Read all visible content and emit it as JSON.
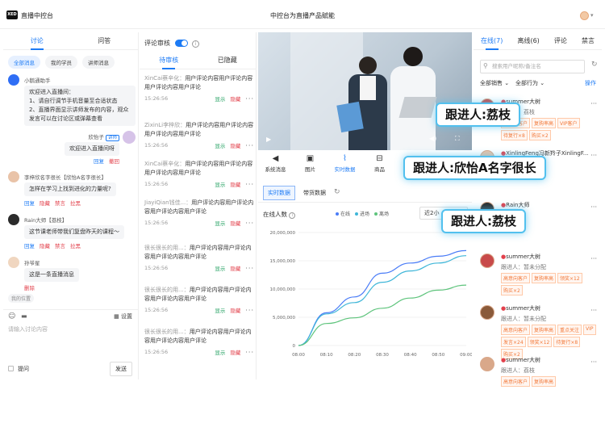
{
  "header": {
    "logo": "XED",
    "app_title": "直播中控台",
    "page_title": "中控台为直播产品赋能"
  },
  "chat": {
    "tabs": [
      "讨论",
      "问答"
    ],
    "filters": [
      "全部消息",
      "我的学员",
      "讲师消息"
    ],
    "assistant": {
      "name": "小鹅通助手",
      "text": "欢迎进入直播间：\n1、请自行调节手机音量至合适状态\n2、直播界面显示讲师发布的内容，观众发言可以在讨论区或弹幕查看"
    },
    "teacher": {
      "name": "欣怡子",
      "badge": "讲师",
      "text": "欢迎进入直播间呀",
      "actions": [
        "回复",
        "撤回"
      ]
    },
    "m1": {
      "name": "李梓欣名字很长【欣怡A名字很长】",
      "text": "怎样在学习上找到进化的力量呢?",
      "actions": [
        "回复",
        "隐藏",
        "禁言",
        "拉黑"
      ]
    },
    "m2": {
      "name": "Rain大师【荔枝】",
      "text": "这节课老师带我们复盘昨天的课程～",
      "actions": [
        "回复",
        "隐藏",
        "禁言",
        "拉黑"
      ]
    },
    "m3": {
      "name": "孙爷星",
      "text": "这是一条直播消息",
      "action": "删除",
      "location": "我的位置"
    },
    "composer": {
      "settings": "设置",
      "placeholder": "请输入讨论内容",
      "question": "提问",
      "send": "发送"
    }
  },
  "review": {
    "title": "评论审核",
    "tabs": [
      "待审核",
      "已隐藏"
    ],
    "items": [
      {
        "nick": "XinCai蔡辛化：",
        "text": "用户评论内容用户评论内容用户评论内容用户评论",
        "time": "15:26:56"
      },
      {
        "nick": "ZixinLi李梓欣：",
        "text": "用户评论内容用户评论内容用户评论内容用户评论",
        "time": "15:26:56"
      },
      {
        "nick": "XinCai蔡辛化：",
        "text": "用户评论内容用户评论内容用户评论内容用户评论",
        "time": "15:26:56"
      },
      {
        "nick": "JiayiQian钱佳...：",
        "text": "用户评论内容用户评论内容用户评论内容用户评论",
        "time": "15:26:56"
      },
      {
        "nick": "很长很长的用...：",
        "text": "用户评论内容用户评论内容用户评论内容用户评论",
        "time": "15:26:56"
      },
      {
        "nick": "很长很长的用...：",
        "text": "用户评论内容用户评论内容用户评论内容用户评论",
        "time": "15:26:56"
      },
      {
        "nick": "很长很长的用...：",
        "text": "用户评论内容用户评论内容用户评论内容用户评论",
        "time": "15:26:56"
      }
    ],
    "show": "显示",
    "hide": "隐藏"
  },
  "center": {
    "toolbar": [
      "系统消息",
      "图片",
      "实时数据",
      "商品",
      "评"
    ],
    "subtabs": [
      "实时数据",
      "带货数据"
    ],
    "chart_label": "在线人数",
    "range": "近2小"
  },
  "chart_data": {
    "type": "line",
    "x": [
      "08:00",
      "08:10",
      "08:20",
      "08:30",
      "08:40",
      "08:50",
      "09:00"
    ],
    "legend": [
      "在线",
      "进场",
      "离场"
    ],
    "series": [
      {
        "name": "在线",
        "values": [
          0,
          5800000,
          8600000,
          12800000,
          14600000,
          15800000,
          16800000
        ]
      },
      {
        "name": "进场",
        "values": [
          0,
          5600000,
          7600000,
          11200000,
          13200000,
          14600000,
          15900000
        ]
      },
      {
        "name": "离场",
        "values": [
          0,
          3900000,
          4900000,
          6600000,
          8400000,
          9800000,
          10700000
        ]
      }
    ],
    "yticks": [
      "20,000,000",
      "15,000,000",
      "10,000,000",
      "5,000,000",
      "0"
    ],
    "ylim": [
      0,
      20000000
    ],
    "colors": [
      "#4a7cf7",
      "#3fb6d8",
      "#5ec47c"
    ]
  },
  "viewers": {
    "tabs": [
      "在线(7)",
      "离线(6)",
      "评论",
      "禁言"
    ],
    "search_placeholder": "搜索用户昵称/备注名",
    "sales_filter": "全部销售",
    "all_filter": "全部行为",
    "op": "操作",
    "list": [
      {
        "name": "summer大树",
        "sub": "跟进人：荔枝",
        "tags": [
          "高意向客户",
          "复购率高",
          "VIP客户",
          "待复行×8",
          "购买×2"
        ]
      },
      {
        "name": "XinlingFeng冯新羚子XinlingF...",
        "sub": "",
        "tags": []
      },
      {
        "name": "Rain大师",
        "sub": "",
        "tags": []
      },
      {
        "name": "summer大树",
        "sub": "跟进人：暂未分配",
        "tags": [
          "高意向客户",
          "复购率高",
          "领奖×12",
          "购买×2"
        ]
      },
      {
        "name": "summer大树",
        "sub": "跟进人：暂未分配",
        "tags": [
          "高意向客户",
          "复购率高",
          "重点关注",
          "VIP",
          "发言×24",
          "领奖×12",
          "待复行×8",
          "购买×2"
        ]
      },
      {
        "name": "summer大树",
        "sub": "跟进人：荔枝",
        "tags": [
          "高意向客户",
          "复购率高"
        ]
      }
    ]
  },
  "overlays": [
    "跟进人:荔枝",
    "跟进人:欣怡A名字很长",
    "跟进人:荔枝"
  ]
}
